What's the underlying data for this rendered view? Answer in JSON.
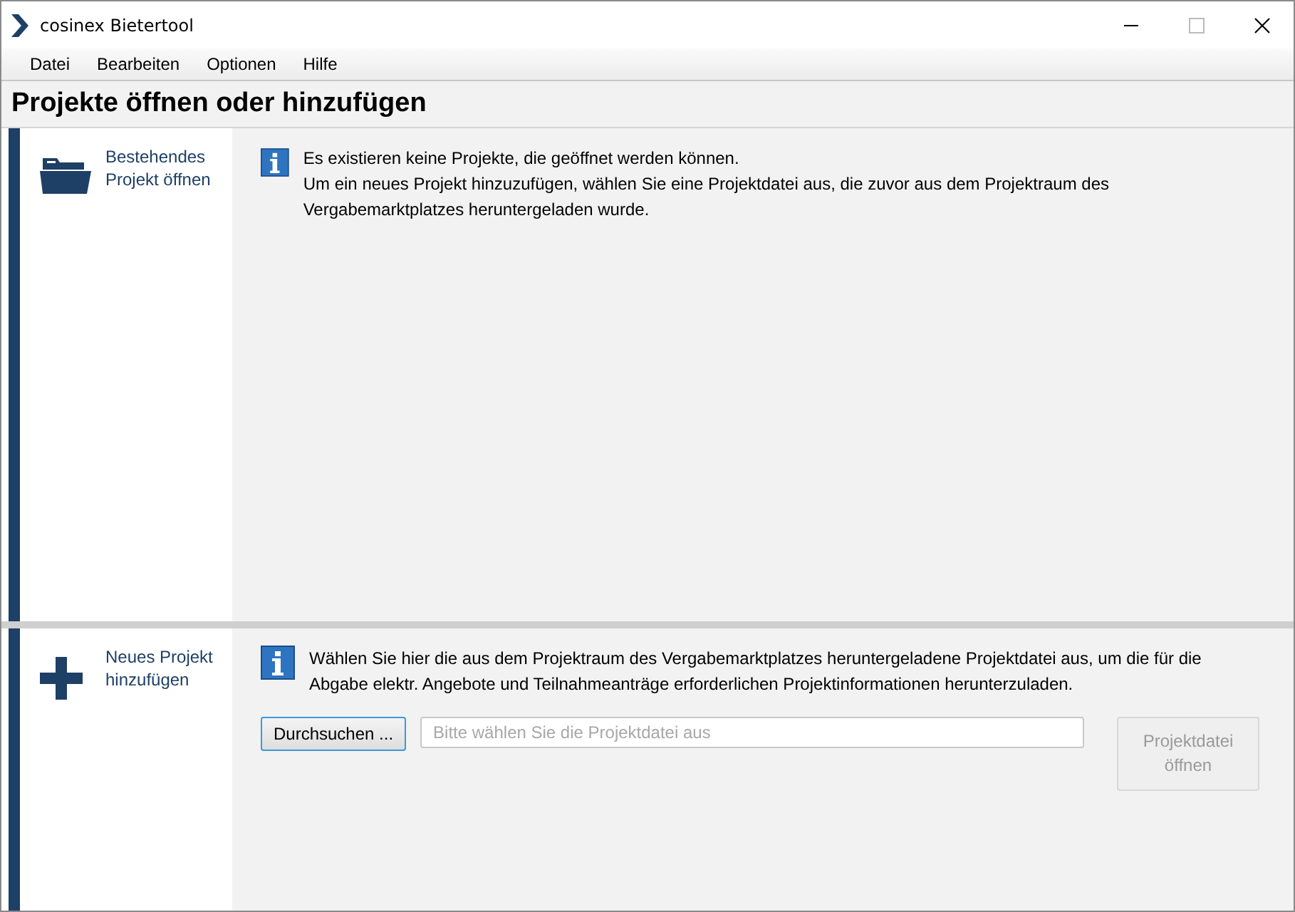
{
  "window": {
    "title": "cosinex Bietertool"
  },
  "menu": [
    {
      "label": "Datei"
    },
    {
      "label": "Bearbeiten"
    },
    {
      "label": "Optionen"
    },
    {
      "label": "Hilfe"
    }
  ],
  "heading": "Projekte öffnen oder hinzufügen",
  "open_section": {
    "label": "Bestehendes Projekt öffnen",
    "messages": [
      "Es existieren keine Projekte, die geöffnet werden können.",
      "Um ein neues Projekt hinzuzufügen, wählen Sie eine Projektdatei aus, die zuvor aus dem Projektraum des Vergabemarktplatzes heruntergeladen wurde."
    ]
  },
  "add_section": {
    "label": "Neues Projekt hinzufügen",
    "message": "Wählen Sie hier die aus dem Projektraum des Vergabemarktplatzes heruntergeladene Projektdatei aus, um die für die Abgabe elektr. Angebote und Teilnahmeanträge erforderlichen Projektinformationen herunterzuladen.",
    "browse_button": {
      "label": "Durchsuchen ..."
    },
    "file_field": {
      "placeholder": "Bitte wählen Sie die Projektdatei aus"
    },
    "open_button": {
      "label": "Projektdatei öffnen",
      "disabled": true
    }
  }
}
